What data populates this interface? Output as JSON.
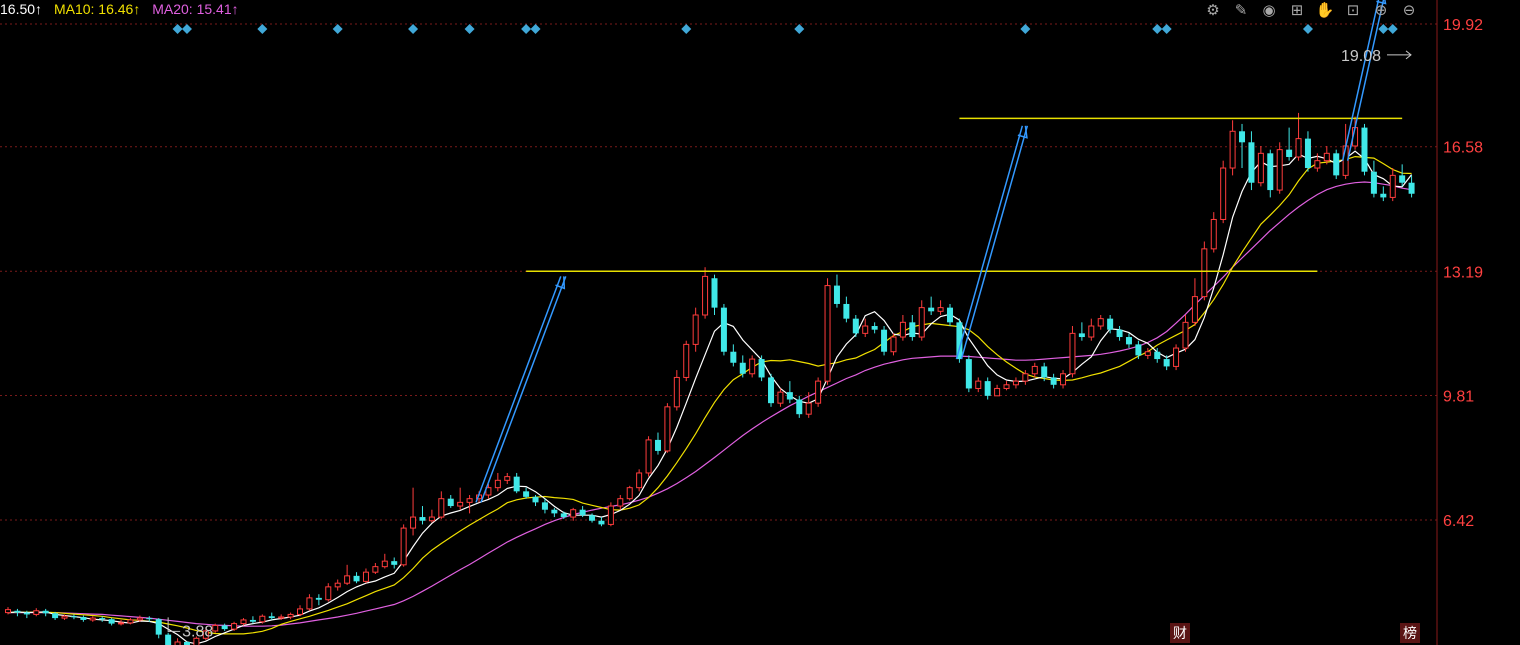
{
  "legend": {
    "ma5_text": "16.50↑",
    "ma10_text": "MA10: 16.46↑",
    "ma20_text": "MA20: 15.41↑",
    "colors": {
      "ma5": "#ffffff",
      "ma10": "#f0e000",
      "ma20": "#e060e0"
    }
  },
  "toolbar": {
    "icons": [
      "gear-icon",
      "pen-icon",
      "eye-icon",
      "gift-icon",
      "hand-icon",
      "lock-icon",
      "zoom-in-icon",
      "zoom-out-icon"
    ],
    "glyphs": [
      "⚙",
      "✎",
      "◉",
      "⊞",
      "✋",
      "⊡",
      "⊕",
      "⊖"
    ]
  },
  "badges": {
    "finance": "财",
    "ranking": "榜"
  },
  "chart_data": {
    "type": "candlestick",
    "price_axis": {
      "ticks": [
        19.92,
        16.58,
        13.19,
        9.81,
        6.42
      ],
      "range": [
        3.0,
        20.8
      ]
    },
    "grid": true,
    "colors": {
      "up": "#ff3c3c",
      "down": "#40e8e8",
      "grid": "#7a1a1a",
      "axis_text": "#ff4040",
      "annot_line": "#e8e000",
      "arrow": "#3399ff",
      "marker": "#40a8d8"
    },
    "annotations": {
      "low_label": "3.88",
      "high_label": "19.08",
      "low_value": 3.88,
      "high_value": 19.08
    },
    "resistance_lines": [
      {
        "price": 13.19,
        "from_index": 55,
        "to_index": 139
      },
      {
        "price": 17.35,
        "from_index": 101,
        "to_index": 148
      }
    ],
    "marker_indices": [
      18,
      19,
      27,
      35,
      43,
      49,
      55,
      56,
      72,
      84,
      108,
      122,
      123,
      138,
      146,
      147
    ],
    "arrows": [
      {
        "from_index": 50,
        "from_price": 6.9,
        "to_index": 59,
        "to_price": 13.05
      },
      {
        "from_index": 101,
        "from_price": 10.8,
        "to_index": 108,
        "to_price": 17.15
      },
      {
        "from_index": 142,
        "from_price": 16.2,
        "to_index": 146,
        "to_price": 20.8
      }
    ],
    "candles": [
      [
        3.9,
        3.98,
        3.85,
        4.05
      ],
      [
        3.95,
        3.9,
        3.8,
        4.0
      ],
      [
        3.9,
        3.85,
        3.75,
        3.95
      ],
      [
        3.85,
        3.95,
        3.8,
        4.02
      ],
      [
        3.95,
        3.88,
        3.8,
        4.0
      ],
      [
        3.88,
        3.75,
        3.7,
        3.92
      ],
      [
        3.75,
        3.8,
        3.7,
        3.85
      ],
      [
        3.8,
        3.78,
        3.72,
        3.85
      ],
      [
        3.78,
        3.7,
        3.65,
        3.82
      ],
      [
        3.7,
        3.75,
        3.65,
        3.8
      ],
      [
        3.75,
        3.72,
        3.65,
        3.8
      ],
      [
        3.72,
        3.6,
        3.55,
        3.75
      ],
      [
        3.6,
        3.62,
        3.55,
        3.7
      ],
      [
        3.62,
        3.7,
        3.58,
        3.75
      ],
      [
        3.7,
        3.75,
        3.65,
        3.82
      ],
      [
        3.75,
        3.72,
        3.65,
        3.8
      ],
      [
        3.72,
        3.3,
        3.2,
        3.75
      ],
      [
        3.3,
        2.95,
        2.88,
        3.35
      ],
      [
        2.95,
        3.1,
        2.9,
        3.2
      ],
      [
        3.1,
        3.0,
        2.9,
        3.12
      ],
      [
        3.0,
        3.2,
        2.95,
        3.25
      ],
      [
        3.2,
        3.4,
        3.15,
        3.45
      ],
      [
        3.4,
        3.55,
        3.35,
        3.6
      ],
      [
        3.55,
        3.45,
        3.4,
        3.6
      ],
      [
        3.45,
        3.6,
        3.4,
        3.65
      ],
      [
        3.6,
        3.7,
        3.55,
        3.75
      ],
      [
        3.7,
        3.65,
        3.6,
        3.8
      ],
      [
        3.65,
        3.8,
        3.6,
        3.85
      ],
      [
        3.8,
        3.75,
        3.7,
        3.9
      ],
      [
        3.75,
        3.78,
        3.7,
        3.85
      ],
      [
        3.78,
        3.85,
        3.72,
        3.9
      ],
      [
        3.85,
        4.0,
        3.8,
        4.1
      ],
      [
        4.0,
        4.3,
        3.95,
        4.4
      ],
      [
        4.3,
        4.25,
        4.1,
        4.4
      ],
      [
        4.25,
        4.6,
        4.2,
        4.7
      ],
      [
        4.6,
        4.7,
        4.5,
        4.8
      ],
      [
        4.7,
        4.9,
        4.65,
        5.2
      ],
      [
        4.9,
        4.75,
        4.7,
        5.0
      ],
      [
        4.75,
        5.0,
        4.7,
        5.1
      ],
      [
        5.0,
        5.15,
        4.95,
        5.25
      ],
      [
        5.15,
        5.3,
        5.1,
        5.5
      ],
      [
        5.3,
        5.2,
        5.1,
        5.4
      ],
      [
        5.2,
        6.2,
        5.15,
        6.3
      ],
      [
        6.2,
        6.5,
        6.0,
        7.3
      ],
      [
        6.5,
        6.4,
        6.3,
        6.8
      ],
      [
        6.4,
        6.5,
        6.35,
        6.7
      ],
      [
        6.5,
        7.0,
        6.45,
        7.2
      ],
      [
        7.0,
        6.8,
        6.75,
        7.1
      ],
      [
        6.8,
        6.9,
        6.7,
        7.3
      ],
      [
        6.9,
        7.0,
        6.6,
        7.1
      ],
      [
        7.0,
        7.1,
        6.9,
        7.2
      ],
      [
        7.1,
        7.3,
        7.0,
        7.4
      ],
      [
        7.3,
        7.5,
        7.2,
        7.7
      ],
      [
        7.5,
        7.6,
        7.4,
        7.7
      ],
      [
        7.6,
        7.2,
        7.15,
        7.7
      ],
      [
        7.2,
        7.05,
        7.0,
        7.3
      ],
      [
        7.05,
        6.9,
        6.8,
        7.1
      ],
      [
        6.9,
        6.7,
        6.6,
        7.0
      ],
      [
        6.7,
        6.6,
        6.5,
        6.75
      ],
      [
        6.6,
        6.5,
        6.45,
        6.65
      ],
      [
        6.5,
        6.7,
        6.4,
        6.75
      ],
      [
        6.7,
        6.55,
        6.5,
        6.8
      ],
      [
        6.55,
        6.4,
        6.35,
        6.6
      ],
      [
        6.4,
        6.3,
        6.25,
        6.5
      ],
      [
        6.3,
        6.8,
        6.25,
        6.9
      ],
      [
        6.8,
        7.0,
        6.7,
        7.1
      ],
      [
        7.0,
        7.3,
        6.95,
        7.35
      ],
      [
        7.3,
        7.7,
        7.2,
        7.8
      ],
      [
        7.7,
        8.6,
        7.6,
        8.7
      ],
      [
        8.6,
        8.3,
        8.2,
        8.8
      ],
      [
        8.3,
        9.5,
        8.25,
        9.6
      ],
      [
        9.5,
        10.3,
        9.4,
        10.5
      ],
      [
        10.3,
        11.2,
        10.2,
        11.3
      ],
      [
        11.2,
        12.0,
        11.0,
        12.2
      ],
      [
        12.0,
        13.05,
        11.9,
        13.3
      ],
      [
        13.0,
        12.2,
        12.0,
        13.1
      ],
      [
        12.2,
        11.0,
        10.9,
        12.3
      ],
      [
        11.0,
        10.7,
        10.6,
        11.2
      ],
      [
        10.7,
        10.4,
        10.3,
        10.9
      ],
      [
        10.4,
        10.8,
        10.3,
        10.9
      ],
      [
        10.8,
        10.3,
        10.2,
        10.9
      ],
      [
        10.3,
        9.6,
        9.5,
        10.4
      ],
      [
        9.6,
        9.9,
        9.5,
        10.0
      ],
      [
        9.9,
        9.7,
        9.6,
        10.2
      ],
      [
        9.7,
        9.3,
        9.2,
        9.8
      ],
      [
        9.3,
        9.6,
        9.2,
        9.9
      ],
      [
        9.6,
        10.2,
        9.5,
        10.3
      ],
      [
        10.2,
        12.8,
        10.1,
        13.0
      ],
      [
        12.8,
        12.3,
        12.2,
        13.1
      ],
      [
        12.3,
        11.9,
        11.8,
        12.5
      ],
      [
        11.9,
        11.5,
        11.4,
        12.0
      ],
      [
        11.5,
        11.7,
        11.4,
        11.9
      ],
      [
        11.7,
        11.6,
        11.5,
        11.8
      ],
      [
        11.6,
        11.0,
        10.9,
        11.7
      ],
      [
        11.0,
        11.4,
        10.9,
        11.5
      ],
      [
        11.4,
        11.8,
        11.3,
        12.0
      ],
      [
        11.8,
        11.4,
        11.3,
        12.0
      ],
      [
        11.4,
        12.2,
        11.3,
        12.4
      ],
      [
        12.2,
        12.1,
        12.0,
        12.5
      ],
      [
        12.1,
        12.2,
        12.0,
        12.4
      ],
      [
        12.2,
        11.8,
        11.7,
        12.3
      ],
      [
        11.8,
        10.8,
        10.7,
        11.9
      ],
      [
        10.8,
        10.0,
        9.9,
        10.9
      ],
      [
        10.0,
        10.2,
        9.9,
        10.3
      ],
      [
        10.2,
        9.8,
        9.7,
        10.3
      ],
      [
        9.8,
        10.0,
        9.8,
        10.1
      ],
      [
        10.0,
        10.1,
        9.95,
        10.2
      ],
      [
        10.1,
        10.2,
        10.0,
        10.3
      ],
      [
        10.2,
        10.4,
        10.1,
        10.5
      ],
      [
        10.4,
        10.6,
        10.3,
        10.7
      ],
      [
        10.6,
        10.3,
        10.2,
        10.7
      ],
      [
        10.3,
        10.1,
        10.0,
        10.4
      ],
      [
        10.1,
        10.4,
        10.0,
        10.5
      ],
      [
        10.4,
        11.5,
        10.3,
        11.7
      ],
      [
        11.5,
        11.4,
        11.3,
        11.8
      ],
      [
        11.4,
        11.7,
        11.3,
        11.9
      ],
      [
        11.7,
        11.9,
        11.6,
        12.0
      ],
      [
        11.9,
        11.6,
        11.5,
        12.0
      ],
      [
        11.6,
        11.4,
        11.3,
        11.7
      ],
      [
        11.4,
        11.2,
        11.1,
        11.5
      ],
      [
        11.2,
        10.9,
        10.8,
        11.3
      ],
      [
        10.9,
        11.0,
        10.8,
        11.1
      ],
      [
        11.0,
        10.8,
        10.7,
        11.1
      ],
      [
        10.8,
        10.6,
        10.5,
        10.9
      ],
      [
        10.6,
        11.1,
        10.5,
        11.2
      ],
      [
        11.1,
        11.8,
        11.0,
        12.0
      ],
      [
        11.8,
        12.5,
        11.7,
        13.0
      ],
      [
        12.5,
        13.8,
        12.4,
        14.0
      ],
      [
        13.8,
        14.6,
        13.7,
        14.8
      ],
      [
        14.6,
        16.0,
        14.5,
        16.2
      ],
      [
        16.0,
        17.0,
        15.8,
        17.3
      ],
      [
        17.0,
        16.7,
        16.0,
        17.2
      ],
      [
        16.7,
        15.6,
        15.4,
        17.0
      ],
      [
        15.6,
        16.4,
        15.5,
        16.6
      ],
      [
        16.4,
        15.4,
        15.2,
        16.5
      ],
      [
        15.4,
        16.5,
        15.3,
        16.7
      ],
      [
        16.5,
        16.3,
        16.2,
        17.1
      ],
      [
        16.3,
        16.8,
        16.2,
        17.5
      ],
      [
        16.8,
        16.0,
        15.9,
        17.0
      ],
      [
        16.0,
        16.2,
        15.9,
        16.4
      ],
      [
        16.2,
        16.4,
        16.1,
        16.6
      ],
      [
        16.4,
        15.8,
        15.7,
        16.5
      ],
      [
        15.8,
        16.6,
        15.7,
        17.2
      ],
      [
        16.6,
        17.1,
        16.5,
        17.4
      ],
      [
        17.1,
        15.9,
        15.8,
        17.2
      ],
      [
        15.9,
        15.3,
        15.2,
        16.2
      ],
      [
        15.3,
        15.2,
        15.1,
        15.5
      ],
      [
        15.2,
        15.8,
        15.1,
        16.0
      ],
      [
        15.8,
        15.6,
        15.5,
        16.1
      ],
      [
        15.6,
        15.3,
        15.2,
        15.8
      ]
    ],
    "ma5": [
      3.9,
      3.92,
      3.9,
      3.91,
      3.92,
      3.85,
      3.82,
      3.79,
      3.76,
      3.72,
      3.7,
      3.68,
      3.64,
      3.61,
      3.67,
      3.66,
      3.6,
      3.45,
      3.3,
      3.1,
      3.05,
      3.12,
      3.25,
      3.35,
      3.45,
      3.55,
      3.6,
      3.64,
      3.7,
      3.74,
      3.78,
      3.83,
      3.94,
      4.03,
      4.16,
      4.31,
      4.47,
      4.6,
      4.7,
      4.76,
      4.87,
      4.97,
      5.3,
      5.7,
      6.06,
      6.33,
      6.53,
      6.61,
      6.68,
      6.79,
      6.89,
      6.98,
      7.1,
      7.28,
      7.34,
      7.33,
      7.19,
      7.0,
      6.79,
      6.62,
      6.55,
      6.55,
      6.55,
      6.5,
      6.57,
      6.68,
      6.85,
      7.09,
      7.55,
      7.9,
      8.36,
      8.94,
      9.6,
      10.28,
      10.92,
      11.56,
      11.79,
      11.69,
      11.32,
      11.05,
      10.78,
      10.34,
      10.0,
      9.8,
      9.65,
      9.6,
      9.72,
      10.28,
      10.86,
      11.21,
      11.46,
      11.98,
      12.09,
      11.85,
      11.48,
      11.44,
      11.51,
      11.48,
      11.76,
      11.96,
      12.02,
      11.86,
      11.36,
      10.99,
      10.62,
      10.37,
      10.23,
      10.19,
      10.2,
      10.26,
      10.32,
      10.28,
      10.26,
      10.44,
      10.66,
      10.86,
      11.3,
      11.62,
      11.6,
      11.52,
      11.34,
      11.23,
      10.99,
      10.84,
      10.96,
      11.07,
      11.33,
      11.93,
      12.74,
      13.64,
      14.66,
      15.36,
      15.88,
      16.17,
      16.04,
      16.06,
      16.1,
      16.38,
      16.26,
      16.32,
      16.25,
      16.12,
      16.26,
      16.46,
      16.25,
      15.82,
      15.71,
      15.51,
      15.49,
      15.82
    ],
    "ma10": [
      3.9,
      3.91,
      3.91,
      3.91,
      3.91,
      3.9,
      3.88,
      3.86,
      3.84,
      3.82,
      3.8,
      3.76,
      3.73,
      3.7,
      3.69,
      3.66,
      3.64,
      3.59,
      3.54,
      3.48,
      3.41,
      3.36,
      3.33,
      3.32,
      3.32,
      3.32,
      3.35,
      3.39,
      3.47,
      3.58,
      3.66,
      3.73,
      3.8,
      3.88,
      3.96,
      4.05,
      4.14,
      4.25,
      4.36,
      4.47,
      4.56,
      4.65,
      4.85,
      5.1,
      5.38,
      5.6,
      5.78,
      5.95,
      6.12,
      6.28,
      6.43,
      6.58,
      6.72,
      6.89,
      6.97,
      7.02,
      7.04,
      7.06,
      7.03,
      7.01,
      6.98,
      6.88,
      6.82,
      6.76,
      6.7,
      6.69,
      6.74,
      6.83,
      7.03,
      7.3,
      7.62,
      7.98,
      8.36,
      8.77,
      9.21,
      9.62,
      9.97,
      10.24,
      10.4,
      10.58,
      10.72,
      10.76,
      10.75,
      10.78,
      10.73,
      10.68,
      10.61,
      10.66,
      10.7,
      10.78,
      10.83,
      10.95,
      11.06,
      11.25,
      11.44,
      11.55,
      11.68,
      11.73,
      11.77,
      11.74,
      11.71,
      11.68,
      11.6,
      11.4,
      11.14,
      10.92,
      10.72,
      10.55,
      10.39,
      10.31,
      10.27,
      10.23,
      10.22,
      10.23,
      10.29,
      10.36,
      10.42,
      10.51,
      10.6,
      10.74,
      10.88,
      11.0,
      11.18,
      11.32,
      11.45,
      11.58,
      11.74,
      12.06,
      12.42,
      12.83,
      13.3,
      13.71,
      14.09,
      14.47,
      14.72,
      14.98,
      15.27,
      15.65,
      15.98,
      16.13,
      16.16,
      16.19,
      16.23,
      16.31,
      16.29,
      16.27,
      16.12,
      15.96,
      15.86,
      15.85
    ],
    "ma20": [
      3.9,
      3.9,
      3.9,
      3.9,
      3.9,
      3.9,
      3.89,
      3.88,
      3.87,
      3.86,
      3.85,
      3.83,
      3.81,
      3.79,
      3.77,
      3.75,
      3.72,
      3.69,
      3.66,
      3.63,
      3.6,
      3.58,
      3.56,
      3.55,
      3.54,
      3.53,
      3.53,
      3.53,
      3.54,
      3.56,
      3.59,
      3.62,
      3.66,
      3.7,
      3.74,
      3.78,
      3.83,
      3.88,
      3.94,
      4.0,
      4.06,
      4.12,
      4.22,
      4.34,
      4.48,
      4.62,
      4.77,
      4.92,
      5.07,
      5.21,
      5.36,
      5.52,
      5.67,
      5.82,
      5.95,
      6.07,
      6.18,
      6.3,
      6.4,
      6.49,
      6.57,
      6.63,
      6.69,
      6.74,
      6.79,
      6.83,
      6.89,
      6.96,
      7.04,
      7.15,
      7.27,
      7.41,
      7.57,
      7.74,
      7.93,
      8.12,
      8.32,
      8.52,
      8.72,
      8.9,
      9.07,
      9.23,
      9.38,
      9.53,
      9.66,
      9.79,
      9.91,
      10.03,
      10.15,
      10.27,
      10.37,
      10.49,
      10.58,
      10.66,
      10.72,
      10.78,
      10.82,
      10.84,
      10.86,
      10.88,
      10.88,
      10.88,
      10.87,
      10.85,
      10.83,
      10.81,
      10.79,
      10.77,
      10.77,
      10.78,
      10.8,
      10.82,
      10.84,
      10.86,
      10.88,
      10.9,
      10.93,
      10.97,
      11.02,
      11.08,
      11.15,
      11.25,
      11.38,
      11.55,
      11.78,
      12.02,
      12.28,
      12.53,
      12.78,
      13.03,
      13.3,
      13.55,
      13.8,
      14.05,
      14.3,
      14.52,
      14.74,
      14.94,
      15.12,
      15.28,
      15.41,
      15.5,
      15.56,
      15.6,
      15.62,
      15.6,
      15.56,
      15.52,
      15.45,
      15.41
    ]
  }
}
